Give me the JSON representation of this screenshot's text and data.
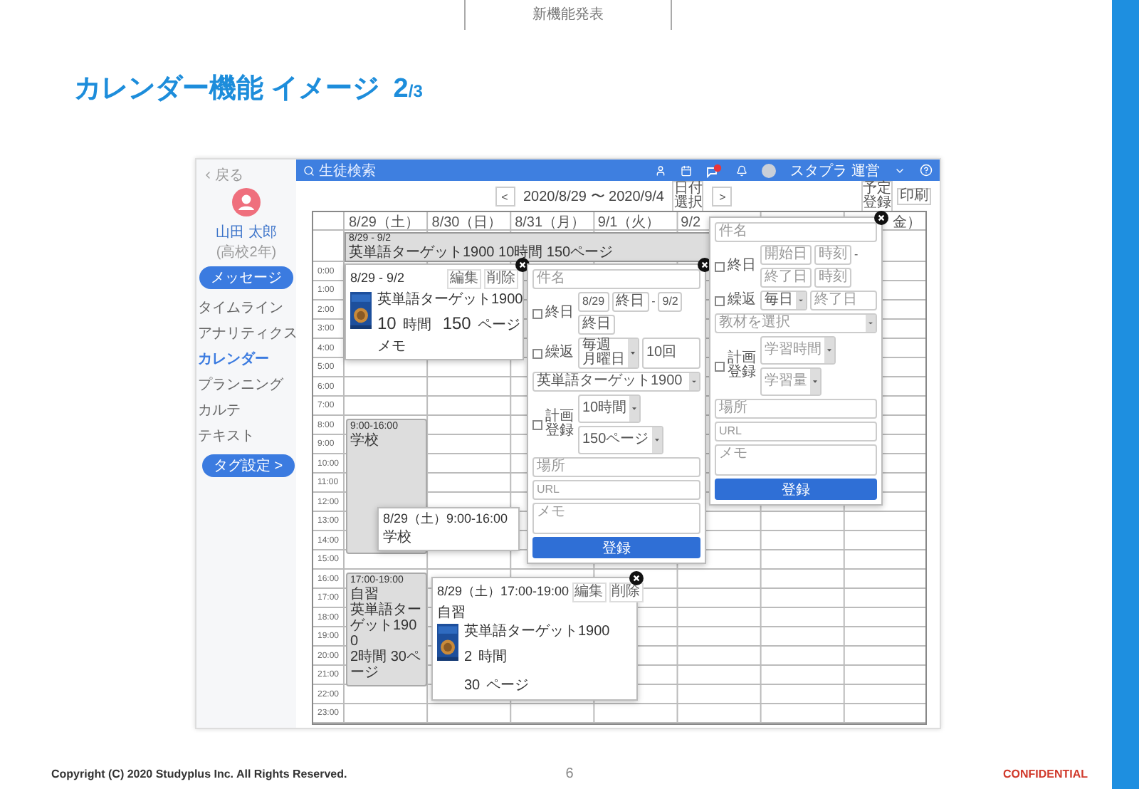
{
  "slide": {
    "header": "新機能発表",
    "title": "カレンダー機能 イメージ",
    "page": "2",
    "page_total": "/3"
  },
  "app": {
    "sidebar": {
      "back": "戻る",
      "user_name": "山田 太郎",
      "user_grade": "(高校2年)",
      "message_button": "メッセージ",
      "items": [
        {
          "label": "タイムライン",
          "selected": false
        },
        {
          "label": "アナリティクス",
          "selected": false
        },
        {
          "label": "カレンダー",
          "selected": true
        },
        {
          "label": "プランニング",
          "selected": false
        },
        {
          "label": "カルテ",
          "selected": false
        },
        {
          "label": "テキスト",
          "selected": false
        }
      ],
      "tag_button": "タグ設定 >"
    },
    "topbar": {
      "search_placeholder": "生徒検索",
      "account": "スタプラ 運営"
    },
    "toolbar": {
      "prev": "<",
      "range": "2020/8/29 〜 2020/9/4",
      "date_pick": "日付選択",
      "next": ">",
      "add_event": "予定登録",
      "print": "印刷"
    },
    "calendar": {
      "days": [
        "8/29（土）",
        "8/30（日）",
        "8/31（月）",
        "9/1（火）",
        "9/2",
        "金）"
      ],
      "times": [
        "0:00",
        "1:00",
        "2:00",
        "3:00",
        "4:00",
        "5:00",
        "6:00",
        "7:00",
        "8:00",
        "9:00",
        "10:00",
        "11:00",
        "12:00",
        "13:00",
        "14:00",
        "15:00",
        "16:00",
        "17:00",
        "18:00",
        "19:00",
        "20:00",
        "21:00",
        "22:00",
        "23:00"
      ],
      "all_day_events": [
        {
          "dates": "8/29 - 9/2",
          "summary": "英単語ターゲット1900 10時間 150ページ"
        }
      ],
      "events": [
        {
          "time": "9:00-16:00",
          "title": "学校"
        },
        {
          "time": "17:00-19:00",
          "title": "自習",
          "details": [
            "英単語ターゲット1900",
            "2時間 30ページ"
          ]
        }
      ]
    },
    "popups": [
      {
        "kind": "detail",
        "closable": true,
        "heading": "8/29 - 9/2",
        "edit": "編集",
        "delete": "削除",
        "book": "英単語ターゲット1900",
        "stats": [
          {
            "value": "10",
            "unit": "時間"
          },
          {
            "value": "150",
            "unit": "ページ"
          }
        ],
        "memo": "メモ"
      },
      {
        "kind": "form",
        "closable": true,
        "subject": {
          "placeholder": "件名"
        },
        "all_day": {
          "label": "終日",
          "checked": false,
          "start": [
            {
              "value": "8/29"
            },
            {
              "value": "終日"
            }
          ],
          "separator": "-",
          "end": [
            {
              "value": "9/2"
            },
            {
              "value": "終日"
            }
          ]
        },
        "repeat": {
          "label": "繰返",
          "checked": false,
          "frequency": {
            "lines": [
              "毎週",
              "月曜日"
            ]
          },
          "until": {
            "value": "10回"
          }
        },
        "material": {
          "value": "英単語ターゲット1900"
        },
        "plan": {
          "label": "計画登録",
          "checked": false,
          "time": {
            "value": "10時間"
          },
          "amount": {
            "value": "150ページ"
          }
        },
        "place": {
          "placeholder": "場所"
        },
        "url": {
          "placeholder": "URL"
        },
        "memo": {
          "placeholder": "メモ"
        },
        "submit": "登録"
      },
      {
        "kind": "form",
        "closable": true,
        "subject": {
          "placeholder": "件名"
        },
        "all_day": {
          "label": "終日",
          "checked": false,
          "start": [
            {
              "placeholder": "開始日"
            },
            {
              "placeholder": "時刻"
            }
          ],
          "separator": "-",
          "end": [
            {
              "placeholder": "終了日"
            },
            {
              "placeholder": "時刻"
            }
          ]
        },
        "repeat": {
          "label": "繰返",
          "checked": false,
          "frequency": {
            "value": "毎日"
          },
          "until": {
            "placeholder": "終了日"
          }
        },
        "material": {
          "placeholder": "教材を選択"
        },
        "plan": {
          "label": "計画登録",
          "checked": false,
          "time": {
            "placeholder": "学習時間"
          },
          "amount": {
            "placeholder": "学習量"
          }
        },
        "place": {
          "placeholder": "場所"
        },
        "url": {
          "placeholder": "URL"
        },
        "memo": {
          "placeholder": "メモ"
        },
        "submit": "登録"
      },
      {
        "kind": "summary",
        "closable": false,
        "heading": "8/29（土）9:00-16:00",
        "title": "学校"
      },
      {
        "kind": "detail",
        "closable": true,
        "heading": "8/29（土）17:00-19:00",
        "edit": "編集",
        "delete": "削除",
        "title": "自習",
        "book": "英単語ターゲット1900",
        "stats": [
          {
            "value": "2",
            "unit": "時間"
          },
          {
            "value": "30",
            "unit": "ページ"
          }
        ]
      }
    ]
  },
  "footer": {
    "copyright": "Copyright (C) 2020 Studyplus Inc.  All Rights Reserved.",
    "page_number": "6",
    "confidential": "CONFIDENTIAL"
  }
}
